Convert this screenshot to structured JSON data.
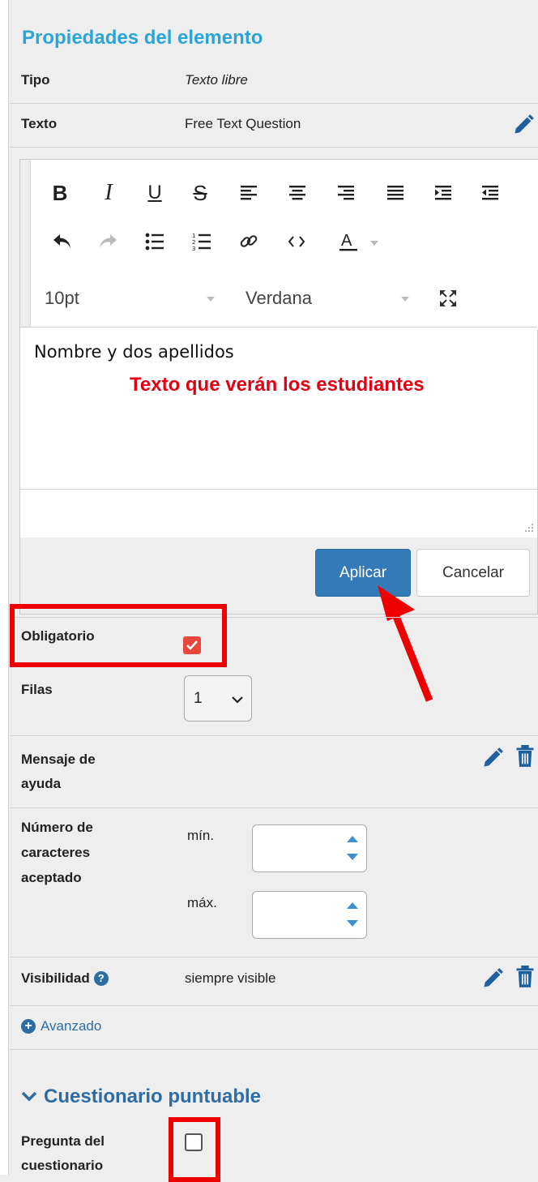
{
  "panel": {
    "title": "Propiedades del elemento"
  },
  "props": {
    "tipo_label": "Tipo",
    "tipo_value": "Texto libre",
    "texto_label": "Texto",
    "texto_value": "Free Text Question"
  },
  "toolbar": {
    "font_size": "10pt",
    "font_family": "Verdana",
    "icons_row1": [
      "bold-icon",
      "italic-icon",
      "underline-icon",
      "strikethrough-icon",
      "align-left-icon",
      "align-center-icon",
      "align-right-icon",
      "align-justify-icon",
      "indent-icon",
      "outdent-icon"
    ],
    "icons_row2": [
      "undo-icon",
      "redo-icon",
      "bullet-list-icon",
      "numbered-list-icon",
      "link-icon",
      "code-icon",
      "text-color-icon"
    ],
    "fullscreen_icon": "fullscreen-icon"
  },
  "editor": {
    "content": "Nombre y dos apellidos",
    "annotation": "Texto que verán los estudiantes"
  },
  "buttons": {
    "apply": "Aplicar",
    "cancel": "Cancelar"
  },
  "fields": {
    "obligatorio_label": "Obligatorio",
    "obligatorio_checked": true,
    "filas_label": "Filas",
    "filas_value": "1",
    "mensaje_label_1": "Mensaje de",
    "mensaje_label_2": "ayuda",
    "numero_label_1": "Número de",
    "numero_label_2": "caracteres",
    "numero_label_3": "aceptado",
    "min_label": "mín.",
    "max_label": "máx.",
    "visibilidad_label": "Visibilidad",
    "visibilidad_value": "siempre visible",
    "advanced_link": "Avanzado"
  },
  "scored_quiz": {
    "section_title": "Cuestionario puntuable",
    "question_label_1": "Pregunta del",
    "question_label_2": "cuestionario",
    "question_checked": false
  },
  "colors": {
    "accent": "#2aa5d6",
    "primary_button": "#337ab7",
    "annotation_red": "#e40012",
    "highlight_box": "#ee0000",
    "checkbox_red": "#e8473e"
  }
}
